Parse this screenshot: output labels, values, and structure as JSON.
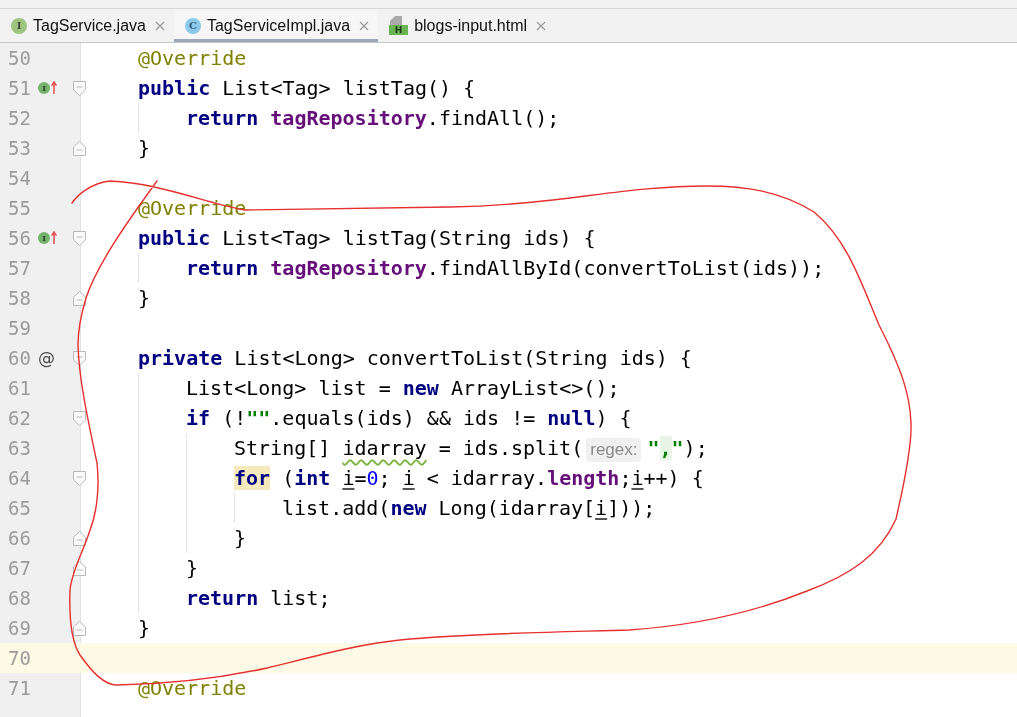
{
  "tabs": [
    {
      "label": "TagService.java",
      "kind": "interface",
      "icon_letter": "I",
      "selected": false
    },
    {
      "label": "TagServiceImpl.java",
      "kind": "class",
      "icon_letter": "C",
      "selected": true
    },
    {
      "label": "blogs-input.html",
      "kind": "html",
      "icon_letter": "H",
      "selected": false
    }
  ],
  "editor": {
    "lines": [
      {
        "number": "50",
        "current": false,
        "tokens": [
          {
            "text": "@Override",
            "kind": "annotation",
            "highlighted": false
          }
        ]
      },
      {
        "number": "51",
        "current": false,
        "marker": {
          "kind": "implements",
          "letter": "I"
        },
        "fold": {
          "kind": "start"
        },
        "tokens": [
          {
            "text": "public",
            "kind": "keyword",
            "highlighted": false
          },
          {
            "text": " List<Tag> listTag() {",
            "kind": "plain",
            "highlighted": false
          }
        ],
        "children": [
          {
            "number": "52",
            "current": false,
            "tokens": [
              {
                "text": "return ",
                "kind": "keyword",
                "highlighted": false
              },
              {
                "text": "tagRepository",
                "kind": "field",
                "highlighted": false
              },
              {
                "text": ".findAll();",
                "kind": "plain",
                "highlighted": false
              }
            ]
          }
        ]
      },
      {
        "number": "53",
        "current": false,
        "fold": {
          "kind": "end"
        },
        "tokens": [
          {
            "text": "}",
            "kind": "plain",
            "highlighted": false
          }
        ]
      },
      {
        "number": "54",
        "current": false
      },
      {
        "number": "55",
        "current": false,
        "tokens": [
          {
            "text": "@Override",
            "kind": "annotation",
            "highlighted": false
          }
        ]
      },
      {
        "number": "56",
        "current": false,
        "marker": {
          "kind": "implements",
          "letter": "I"
        },
        "fold": {
          "kind": "start"
        },
        "tokens": [
          {
            "text": "public",
            "kind": "keyword",
            "highlighted": false
          },
          {
            "text": " List<Tag> listTag(String ids) {",
            "kind": "plain",
            "highlighted": false
          }
        ],
        "children": [
          {
            "number": "57",
            "current": false,
            "tokens": [
              {
                "text": "return ",
                "kind": "keyword",
                "highlighted": false
              },
              {
                "text": "tagRepository",
                "kind": "field",
                "highlighted": false
              },
              {
                "text": ".findAllById(convertToList(ids));",
                "kind": "plain",
                "highlighted": false
              }
            ]
          }
        ]
      },
      {
        "number": "58",
        "current": false,
        "fold": {
          "kind": "end"
        },
        "tokens": [
          {
            "text": "}",
            "kind": "plain",
            "highlighted": false
          }
        ]
      },
      {
        "number": "59",
        "current": false
      },
      {
        "number": "60",
        "current": false,
        "marker": {
          "kind": "symbol",
          "letter": "@"
        },
        "fold": {
          "kind": "start"
        },
        "tokens": [
          {
            "text": "private",
            "kind": "keyword",
            "highlighted": false
          },
          {
            "text": " List<Long> convertToList(String ids) {",
            "kind": "plain",
            "highlighted": false
          }
        ],
        "children": [
          {
            "number": "61",
            "current": false,
            "tokens": [
              {
                "text": "List<Long> list = ",
                "kind": "plain",
                "highlighted": false
              },
              {
                "text": "new",
                "kind": "keyword",
                "highlighted": false
              },
              {
                "text": " ArrayList<>();",
                "kind": "plain",
                "highlighted": false
              }
            ]
          },
          {
            "number": "62",
            "current": false,
            "fold": {
              "kind": "start"
            },
            "tokens": [
              {
                "text": "if",
                "kind": "keyword",
                "highlighted": false
              },
              {
                "text": " (!",
                "kind": "plain",
                "highlighted": false
              },
              {
                "text": "\"\"",
                "kind": "string",
                "highlighted": false
              },
              {
                "text": ".equals(ids) && ids != ",
                "kind": "plain",
                "highlighted": false
              },
              {
                "text": "null",
                "kind": "keyword",
                "highlighted": false
              },
              {
                "text": ") {",
                "kind": "plain",
                "highlighted": false
              }
            ],
            "children": [
              {
                "number": "63",
                "current": false,
                "tokens": [
                  {
                    "text": "String[] ",
                    "kind": "plain",
                    "highlighted": false
                  },
                  {
                    "text": "idarray",
                    "kind": "typo",
                    "highlighted": false
                  },
                  {
                    "text": " = ids.split(",
                    "kind": "plain",
                    "highlighted": false
                  },
                  {
                    "text": "regex:",
                    "kind": "hint",
                    "highlighted": false
                  },
                  {
                    "text": "\"",
                    "kind": "string",
                    "highlighted": false
                  },
                  {
                    "text": ",",
                    "kind": "regex",
                    "highlighted": false
                  },
                  {
                    "text": "\"",
                    "kind": "string",
                    "highlighted": false
                  },
                  {
                    "text": ");",
                    "kind": "plain",
                    "highlighted": false
                  }
                ]
              },
              {
                "number": "64",
                "current": false,
                "fold": {
                  "kind": "start"
                },
                "tokens": [
                  {
                    "text": "for",
                    "kind": "keyword",
                    "highlighted": true
                  },
                  {
                    "text": " (",
                    "kind": "plain",
                    "highlighted": false
                  },
                  {
                    "text": "int ",
                    "kind": "keyword",
                    "highlighted": false
                  },
                  {
                    "text": "i",
                    "kind": "reassigned",
                    "highlighted": false
                  },
                  {
                    "text": "=",
                    "kind": "plain",
                    "highlighted": false
                  },
                  {
                    "text": "0",
                    "kind": "number",
                    "highlighted": false
                  },
                  {
                    "text": "; ",
                    "kind": "plain",
                    "highlighted": false
                  },
                  {
                    "text": "i",
                    "kind": "reassigned",
                    "highlighted": false
                  },
                  {
                    "text": " < idarray.",
                    "kind": "plain",
                    "highlighted": false
                  },
                  {
                    "text": "length",
                    "kind": "field",
                    "highlighted": false
                  },
                  {
                    "text": ";",
                    "kind": "plain",
                    "highlighted": false
                  },
                  {
                    "text": "i",
                    "kind": "reassigned",
                    "highlighted": false
                  },
                  {
                    "text": "++) {",
                    "kind": "plain",
                    "highlighted": false
                  }
                ],
                "children": [
                  {
                    "number": "65",
                    "current": false,
                    "tokens": [
                      {
                        "text": "list.add(",
                        "kind": "plain",
                        "highlighted": false
                      },
                      {
                        "text": "new",
                        "kind": "keyword",
                        "highlighted": false
                      },
                      {
                        "text": " Long(idarray[",
                        "kind": "plain",
                        "highlighted": false
                      },
                      {
                        "text": "i",
                        "kind": "reassigned",
                        "highlighted": false
                      },
                      {
                        "text": "]));",
                        "kind": "plain",
                        "highlighted": false
                      }
                    ]
                  }
                ]
              },
              {
                "number": "66",
                "current": false,
                "fold": {
                  "kind": "end"
                },
                "tokens": [
                  {
                    "text": "}",
                    "kind": "plain",
                    "highlighted": false
                  }
                ]
              }
            ]
          },
          {
            "number": "67",
            "current": false,
            "fold": {
              "kind": "end"
            },
            "tokens": [
              {
                "text": "}",
                "kind": "plain",
                "highlighted": false
              }
            ]
          },
          {
            "number": "68",
            "current": false,
            "tokens": [
              {
                "text": "return",
                "kind": "keyword",
                "highlighted": false
              },
              {
                "text": " list;",
                "kind": "plain",
                "highlighted": false
              }
            ]
          }
        ]
      },
      {
        "number": "69",
        "current": false,
        "fold": {
          "kind": "end"
        },
        "tokens": [
          {
            "text": "}",
            "kind": "plain",
            "highlighted": false
          }
        ]
      },
      {
        "number": "70",
        "current": true
      },
      {
        "number": "71",
        "current": false,
        "tokens": [
          {
            "text": "@Override",
            "kind": "annotation",
            "highlighted": false
          }
        ]
      }
    ]
  }
}
